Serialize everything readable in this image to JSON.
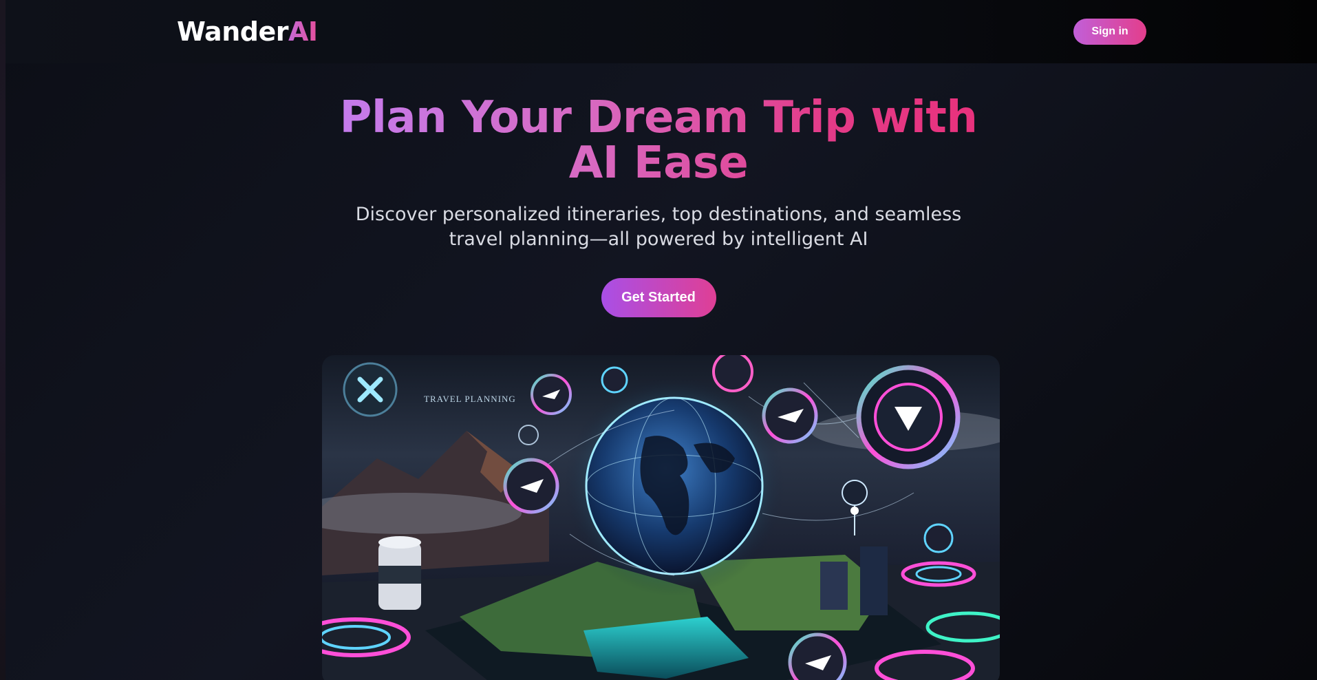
{
  "navbar": {
    "logo_main": "Wander",
    "logo_accent": "AI",
    "signin_label": "Sign in"
  },
  "hero": {
    "headline": "Plan Your Dream Trip with AI Ease",
    "subtitle": "Discover personalized itineraries, top destinations, and seamless travel planning—all powered by intelligent AI",
    "cta_label": "Get Started"
  },
  "illustration": {
    "caption": "TRAVEL PLANNING",
    "icons": [
      "close-icon",
      "airplane-icon",
      "location-pin-icon",
      "play-icon",
      "globe-icon"
    ]
  },
  "colors": {
    "accent_purple": "#c15fd8",
    "accent_pink": "#e33e8c",
    "background": "#0d0f17"
  }
}
